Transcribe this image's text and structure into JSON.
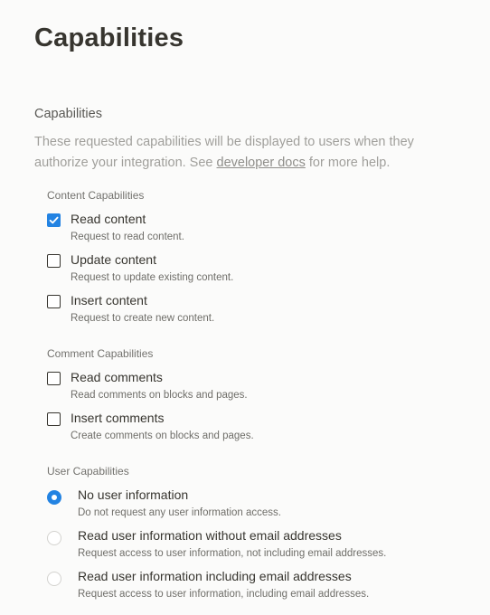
{
  "page": {
    "title": "Capabilities"
  },
  "section": {
    "title": "Capabilities",
    "description_before": "These requested capabilities will be displayed to users when they authorize your integration. See ",
    "link_text": "developer docs",
    "description_after": " for more help."
  },
  "content_capabilities": {
    "label": "Content Capabilities",
    "options": [
      {
        "label": "Read content",
        "description": "Request to read content.",
        "checked": true
      },
      {
        "label": "Update content",
        "description": "Request to update existing content.",
        "checked": false
      },
      {
        "label": "Insert content",
        "description": "Request to create new content.",
        "checked": false
      }
    ]
  },
  "comment_capabilities": {
    "label": "Comment Capabilities",
    "options": [
      {
        "label": "Read comments",
        "description": "Read comments on blocks and pages.",
        "checked": false
      },
      {
        "label": "Insert comments",
        "description": "Create comments on blocks and pages.",
        "checked": false
      }
    ]
  },
  "user_capabilities": {
    "label": "User Capabilities",
    "options": [
      {
        "label": "No user information",
        "description": "Do not request any user information access.",
        "selected": true
      },
      {
        "label": "Read user information without email addresses",
        "description": "Request access to user information, not including email addresses.",
        "selected": false
      },
      {
        "label": "Read user information including email addresses",
        "description": "Request access to user information, including email addresses.",
        "selected": false
      }
    ]
  },
  "colors": {
    "accent": "#2383e2",
    "text": "#37352f",
    "muted": "#a09f9b",
    "background": "#fbfbfa"
  }
}
